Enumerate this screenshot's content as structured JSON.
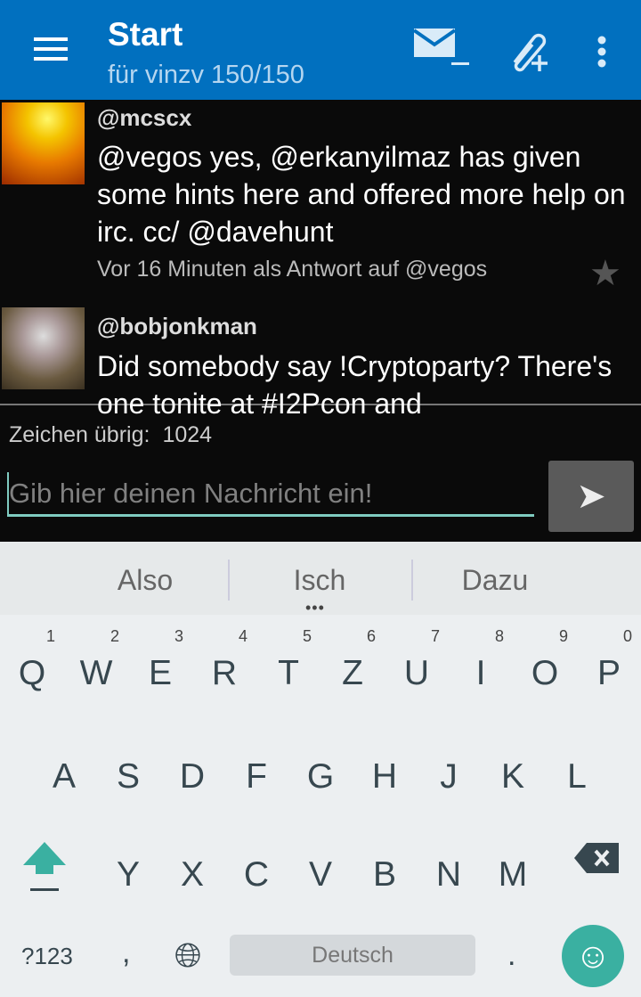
{
  "header": {
    "title": "Start",
    "subtitle": "für vinzv 150/150"
  },
  "tweets": [
    {
      "user": "@mcscx",
      "text": "@vegos yes, @erkanyilmaz has given some hints here and offered more help on irc. cc/ @davehunt",
      "meta": "Vor 16 Minuten als Antwort auf @vegos"
    },
    {
      "user": "@bobjonkman",
      "text": "Did somebody say !Cryptoparty? There's one tonite at #I2Pcon and"
    }
  ],
  "composer": {
    "remaining_label": "Zeichen übrig:",
    "remaining": "1024",
    "placeholder": "Gib hier deinen Nachricht ein!"
  },
  "keyboard": {
    "suggestions": [
      "Also",
      "Isch",
      "Dazu"
    ],
    "row1": [
      "Q",
      "W",
      "E",
      "R",
      "T",
      "Z",
      "U",
      "I",
      "O",
      "P"
    ],
    "row1_hints": [
      "1",
      "2",
      "3",
      "4",
      "5",
      "6",
      "7",
      "8",
      "9",
      "0"
    ],
    "row2": [
      "A",
      "S",
      "D",
      "F",
      "G",
      "H",
      "J",
      "K",
      "L"
    ],
    "row3": [
      "Y",
      "X",
      "C",
      "V",
      "B",
      "N",
      "M"
    ],
    "symbols": "?123",
    "comma": ",",
    "space": "Deutsch",
    "period": "."
  }
}
